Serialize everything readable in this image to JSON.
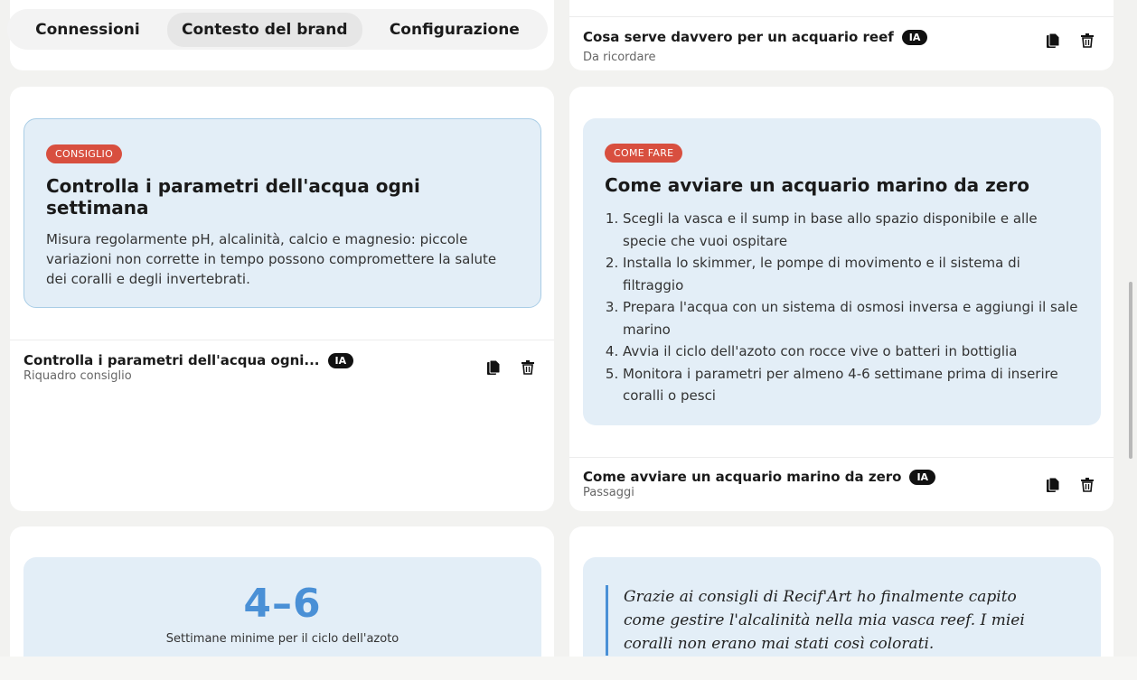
{
  "tabs": [
    {
      "label": "Connessioni"
    },
    {
      "label": "Contesto del brand"
    },
    {
      "label": "Configurazione"
    }
  ],
  "cards": {
    "reef_note": {
      "title": "Cosa serve davvero per un acquario reef",
      "ai_badge": "IA",
      "subtitle": "Da ricordare"
    },
    "tip": {
      "badge": "CONSIGLIO",
      "heading": "Controlla i parametri dell'acqua ogni settimana",
      "body": "Misura regolarmente pH, alcalinità, calcio e magnesio: piccole variazioni non corrette in tempo possono compromettere la salute dei coralli e degli invertebrati.",
      "footer_title": "Controlla i parametri dell'acqua ogni...",
      "ai_badge": "IA",
      "footer_subtitle": "Riquadro consiglio"
    },
    "howto": {
      "badge": "COME FARE",
      "heading": "Come avviare un acquario marino da zero",
      "steps": [
        "Scegli la vasca e il sump in base allo spazio disponibile e alle specie che vuoi ospitare",
        "Installa lo skimmer, le pompe di movimento e il sistema di filtraggio",
        "Prepara l'acqua con un sistema di osmosi inversa e aggiungi il sale marino",
        "Avvia il ciclo dell'azoto con rocce vive o batteri in bottiglia",
        "Monitora i parametri per almeno 4-6 settimane prima di inserire coralli o pesci"
      ],
      "footer_title": "Come avviare un acquario marino da zero",
      "ai_badge": "IA",
      "footer_subtitle": "Passaggi"
    },
    "stat": {
      "value": "4–6",
      "label": "Settimane minime per il ciclo dell'azoto"
    },
    "testimonial": {
      "quote": "Grazie ai consigli di Recif'Art ho finalmente capito come gestire l'alcalinità nella mia vasca reef. I miei coralli non erano mai stati così colorati."
    }
  },
  "icons": {
    "copy": "copy-icon",
    "delete": "trash-icon"
  },
  "colors": {
    "badge_red": "#d84f3f",
    "box_blue": "#e3eef7",
    "accent_blue": "#4a90d6"
  }
}
